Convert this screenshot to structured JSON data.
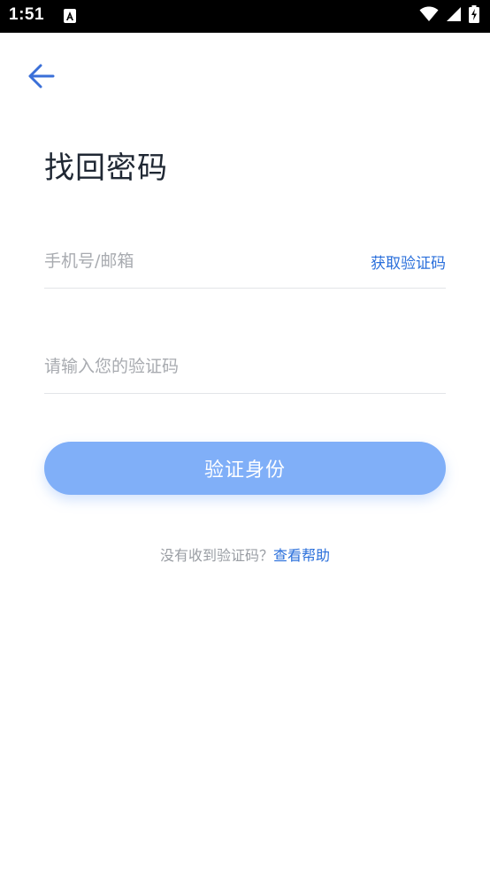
{
  "status_bar": {
    "time": "1:51",
    "icons": [
      "a-notification-icon",
      "wifi-icon",
      "signal-icon",
      "battery-charging-icon"
    ]
  },
  "nav": {
    "back_icon": "arrow-left-icon"
  },
  "page": {
    "title": "找回密码"
  },
  "form": {
    "account": {
      "value": "",
      "placeholder": "手机号/邮箱"
    },
    "get_code_label": "获取验证码",
    "code": {
      "value": "",
      "placeholder": "请输入您的验证码"
    },
    "submit_label": "验证身份"
  },
  "help": {
    "prompt": "没有收到验证码？",
    "link_label": "查看帮助"
  },
  "colors": {
    "accent": "#2a6fdb",
    "button": "#80aff8",
    "title": "#1f2733",
    "placeholder": "#a8abb0",
    "divider": "#e3e5e8"
  }
}
